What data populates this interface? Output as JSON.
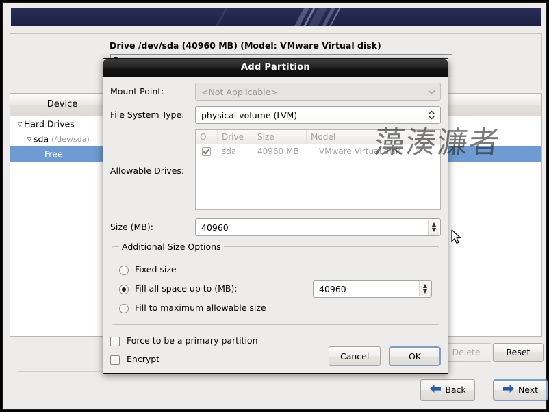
{
  "window": {
    "drive_label": "Drive /dev/sda (40960 MB) (Model: VMware Virtual disk)",
    "partition_bar_label": "Free"
  },
  "tree": {
    "columns": [
      "Device",
      ""
    ],
    "rows": [
      {
        "label": "Hard Drives",
        "sub": "",
        "indent": 0,
        "caret": "▽",
        "selected": false
      },
      {
        "label": "sda",
        "sub": "(/dev/sda)",
        "indent": 1,
        "caret": "▽",
        "selected": false
      },
      {
        "label": "Free",
        "sub": "",
        "indent": 2,
        "caret": "",
        "selected": true
      }
    ]
  },
  "toolbar": {
    "delete_label": "Delete",
    "reset_label": "Reset",
    "back_label": "Back",
    "next_label": "Next",
    "back_icon": "arrow-left-icon",
    "next_icon": "arrow-right-icon"
  },
  "dialog": {
    "title": "Add Partition",
    "mount_point": {
      "label": "Mount Point:",
      "value": "<Not Applicable>",
      "disabled": true,
      "icon": "chevron-down-icon"
    },
    "file_system_type": {
      "label": "File System Type:",
      "value": "physical volume (LVM)",
      "icon": "chevron-up-down-icon"
    },
    "allowable_drives": {
      "label": "Allowable Drives:",
      "columns": [
        "O",
        "Drive",
        "Size",
        "Model"
      ],
      "rows": [
        {
          "checked": true,
          "drive": "sda",
          "size": "40960 MB",
          "model": "VMware Virtual disk"
        }
      ]
    },
    "size": {
      "label": "Size (MB):",
      "value": "40960"
    },
    "additional_size_options": {
      "legend": "Additional Size Options",
      "options": [
        {
          "label": "Fixed size",
          "selected": false,
          "value": null
        },
        {
          "label": "Fill all space up to (MB):",
          "selected": true,
          "value": "40960"
        },
        {
          "label": "Fill to maximum allowable size",
          "selected": false,
          "value": null
        }
      ]
    },
    "checkboxes": [
      {
        "label": "Force to be a primary partition",
        "checked": false
      },
      {
        "label": "Encrypt",
        "checked": false
      }
    ],
    "cancel_label": "Cancel",
    "ok_label": "OK"
  },
  "watermark": {
    "text": "藻湊濂者"
  },
  "colors": {
    "banner": "#23264c",
    "selection": "#6e9bd1",
    "dialog_title_bg": "#141414",
    "window_bg": "#edecea",
    "primary_button_border": "#7d9dc4"
  }
}
